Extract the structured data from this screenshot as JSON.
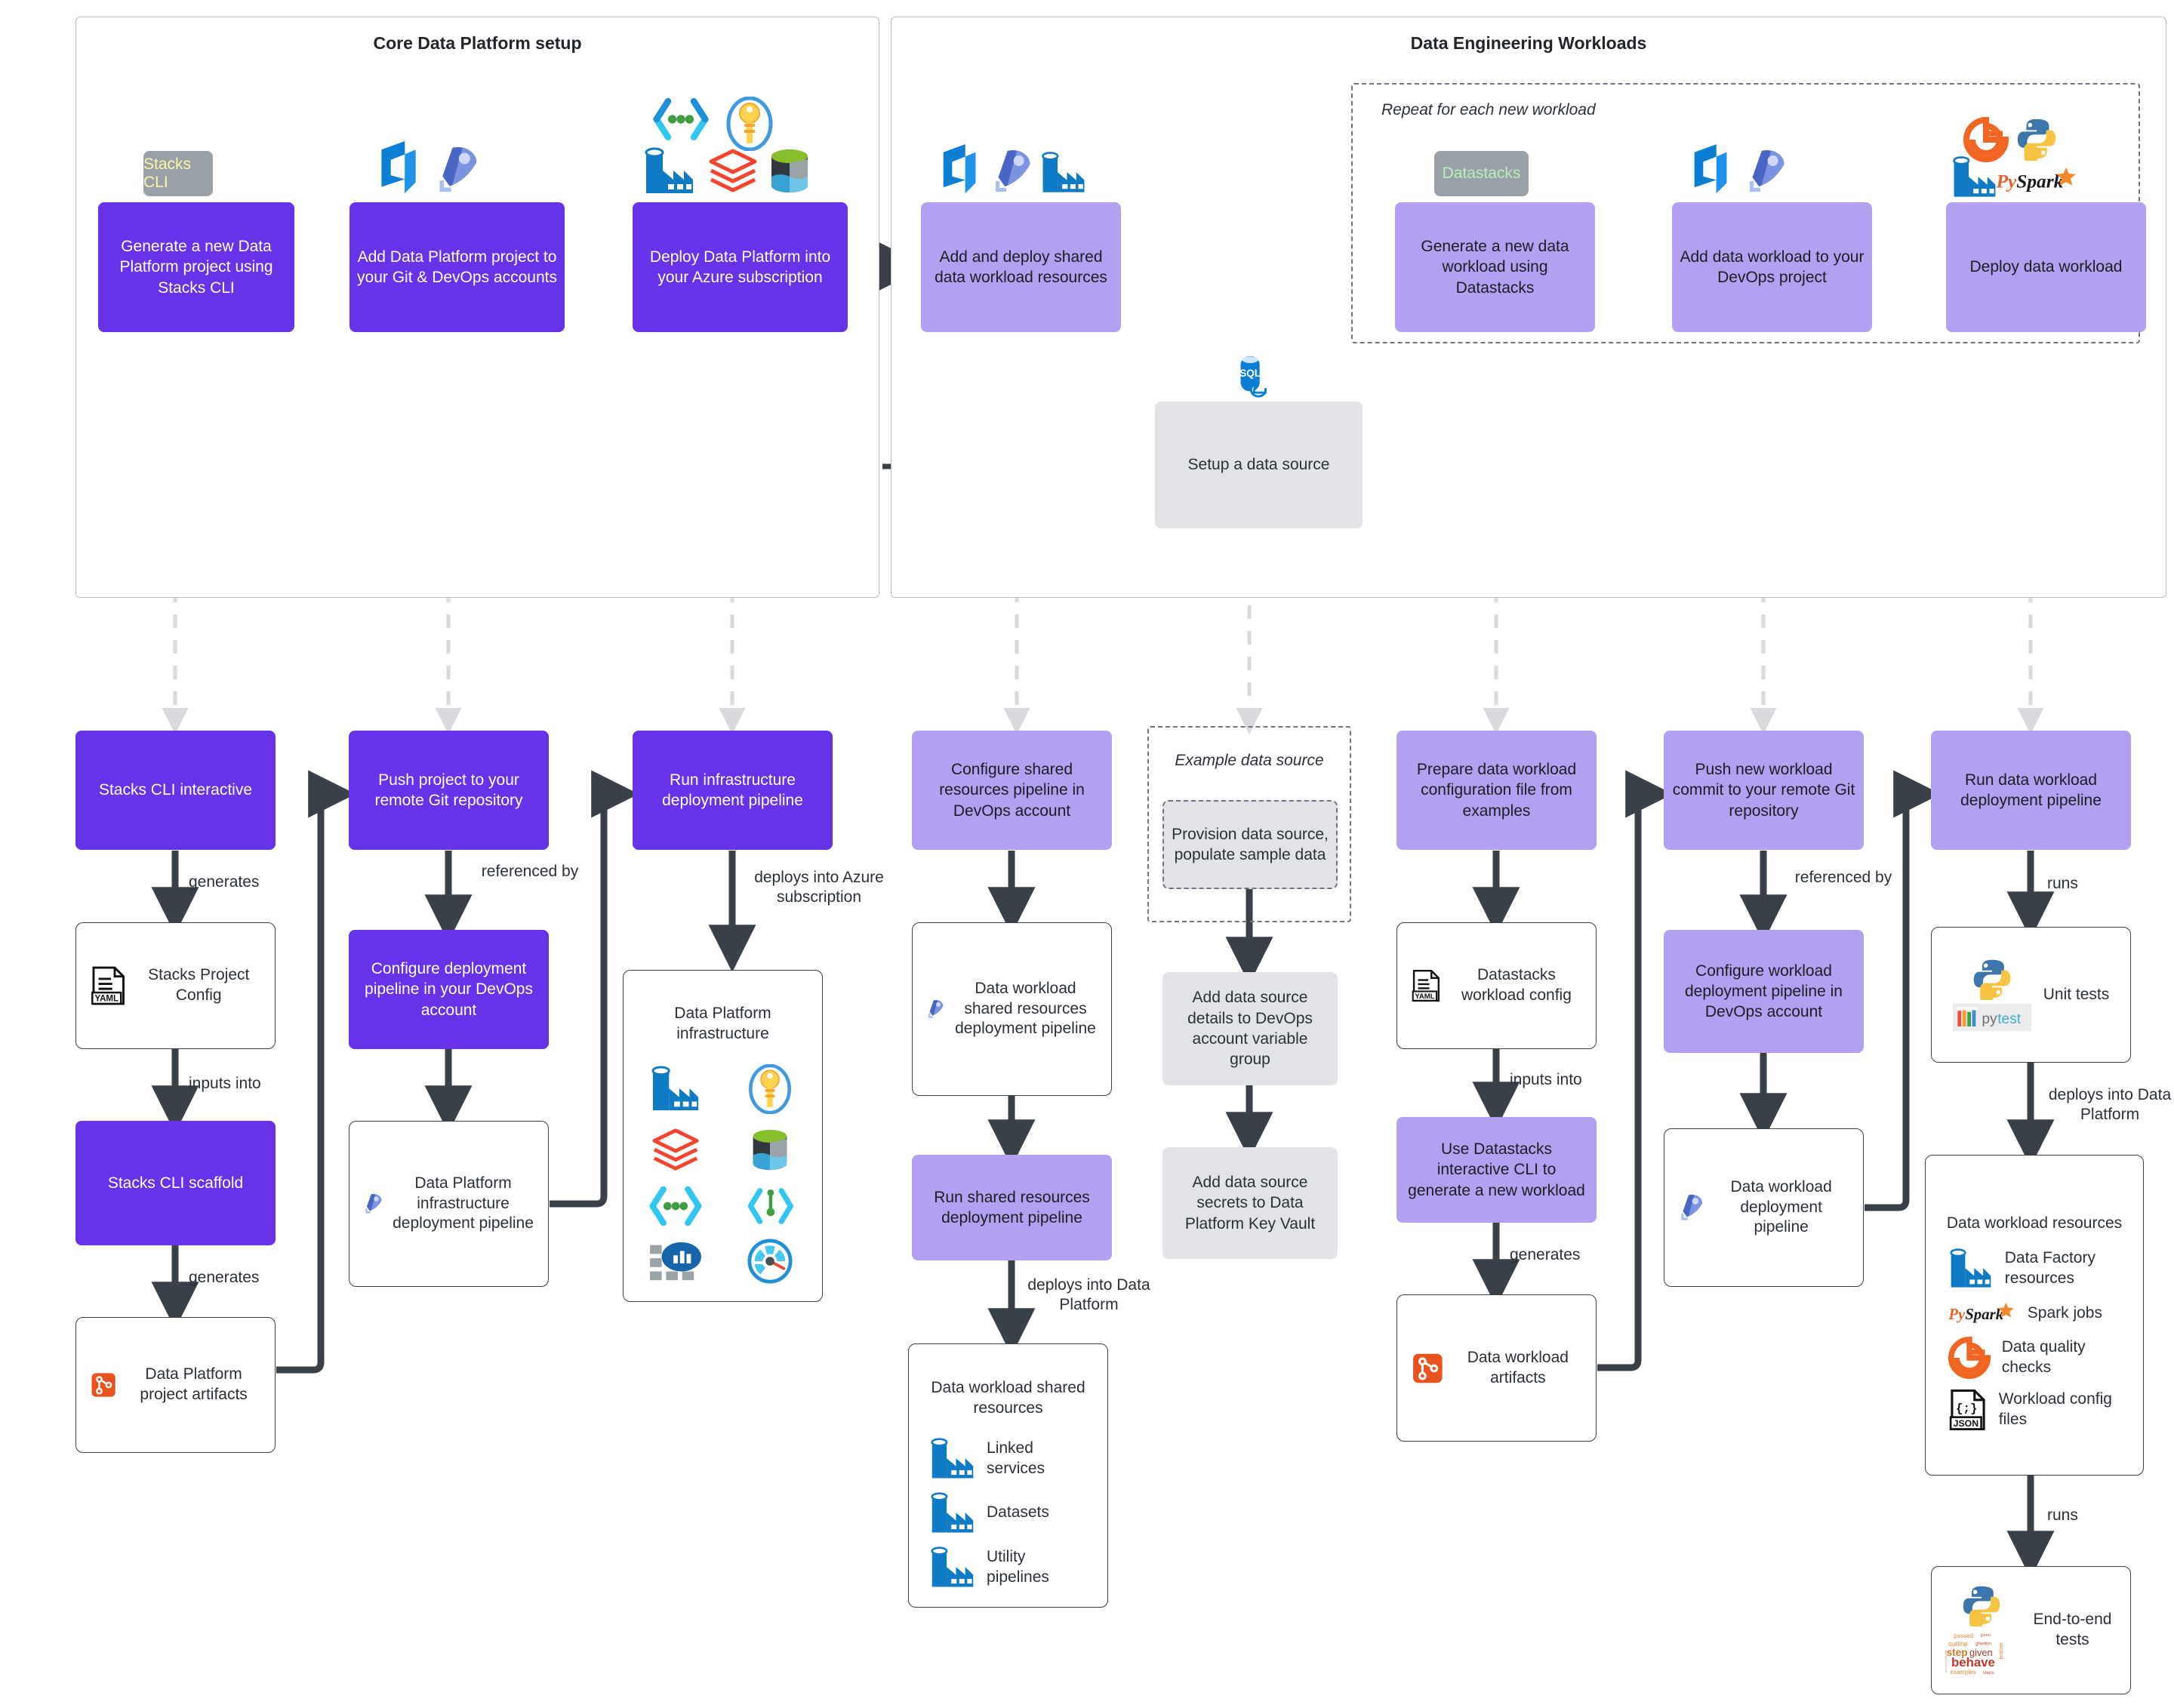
{
  "panels": {
    "core": {
      "title": "Core Data Platform setup"
    },
    "workloads": {
      "title": "Data Engineering Workloads"
    },
    "repeat": {
      "title": "Repeat for each new workload"
    },
    "example_source": {
      "title": "Example data source"
    }
  },
  "badges": {
    "stacks_cli": "Stacks CLI",
    "datastacks": "Datastacks"
  },
  "top_flow": {
    "core_steps": [
      "Generate a new Data Platform project using Stacks CLI",
      "Add Data Platform project to your Git & DevOps accounts",
      "Deploy Data Platform into your Azure subscription"
    ],
    "workload_steps": [
      "Add and deploy shared data workload resources",
      "Generate a new data workload using Datastacks",
      "Add data workload to your DevOps project",
      "Deploy data workload"
    ],
    "data_source_node": "Setup a data source"
  },
  "columns": {
    "c1": {
      "step": "Stacks CLI interactive",
      "edge1": "generates",
      "artifact1": "Stacks Project Config",
      "edge2": "inputs into",
      "step2": "Stacks CLI scaffold",
      "edge3": "generates",
      "artifact2": "Data Platform project artifacts"
    },
    "c2": {
      "step": "Push project to your remote Git repository",
      "edge1": "referenced by",
      "step2": "Configure deployment pipeline in your DevOps account",
      "artifact": "Data Platform infrastructure deployment pipeline"
    },
    "c3": {
      "step": "Run infrastructure deployment pipeline",
      "edge1": "deploys into Azure subscription",
      "artifact_title": "Data Platform infrastructure",
      "artifact_icons": [
        "data-factory-icon",
        "key-vault-icon",
        "databricks-icon",
        "data-lake-icon",
        "synapse-icon",
        "devops-repos-icon",
        "log-analytics-icon",
        "app-insights-icon"
      ]
    },
    "c4": {
      "step": "Configure shared resources pipeline in DevOps account",
      "artifact": "Data workload shared resources deployment pipeline",
      "step2": "Run shared resources deployment pipeline",
      "edge1": "deploys into Data Platform",
      "artifact2_title": "Data workload shared resources",
      "artifact2_items": [
        "Linked services",
        "Datasets",
        "Utility pipelines"
      ]
    },
    "c5": {
      "step": "Provision data source, populate sample data",
      "step2": "Add data source details to DevOps account variable group",
      "step3": "Add data source secrets to Data Platform Key Vault"
    },
    "c6": {
      "step": "Prepare data workload configuration file from examples",
      "artifact": "Datastacks workload config",
      "edge1": "inputs into",
      "step2": "Use Datastacks interactive CLI to generate a new workload",
      "edge2": "generates",
      "artifact2": "Data workload artifacts"
    },
    "c7": {
      "step": "Push new workload commit to your remote Git repository",
      "edge1": "referenced by",
      "step2": "Configure workload deployment pipeline in DevOps account",
      "artifact": "Data workload deployment pipeline"
    },
    "c8": {
      "step": "Run data workload deployment pipeline",
      "edge1": "runs",
      "artifact": "Unit tests",
      "edge2": "deploys into Data Platform",
      "artifact2_title": "Data workload resources",
      "artifact2_items": [
        "Data Factory resources",
        "Spark jobs",
        "Data quality checks",
        "Workload config files"
      ],
      "edge3": "runs",
      "artifact3": "End-to-end tests"
    }
  },
  "colors": {
    "dark_purple": "#6633e8",
    "light_purple": "#b3a0f0",
    "gray_node": "#e2e3e7",
    "arrow": "#3a4048",
    "badge_gray": "#9aa0a8",
    "azure_blue": "#0078d4"
  },
  "icon_names": {
    "yaml_file": "yaml-file-icon",
    "json_file": "json-file-icon",
    "devops_artifacts": "devops-artifacts-icon",
    "devops_pipelines": "devops-pipelines-icon",
    "devops_repos": "devops-repos-icon",
    "data_factory": "data-factory-icon",
    "key_vault": "key-vault-icon",
    "databricks": "databricks-icon",
    "data_lake": "data-lake-icon",
    "synapse": "synapse-icon",
    "sql_db": "azure-sql-database-icon",
    "log_analytics": "log-analytics-icon",
    "app_insights": "application-insights-icon",
    "python": "python-icon",
    "pytest": "pytest-icon",
    "pyspark": "pyspark-icon",
    "great_expectations": "great-expectations-icon",
    "behave": "behave-icon"
  }
}
